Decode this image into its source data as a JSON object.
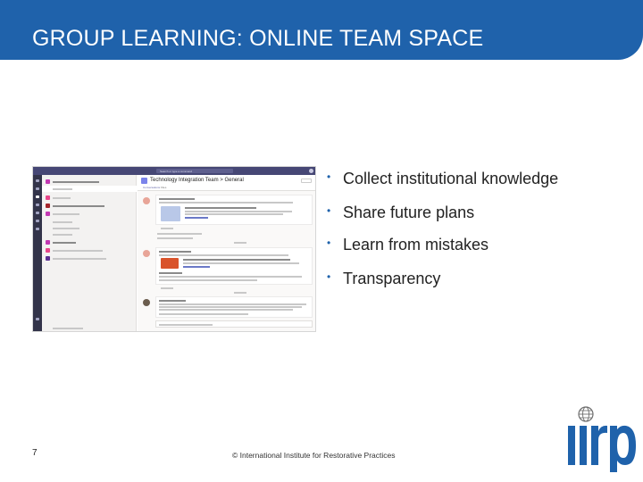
{
  "slide": {
    "title": "GROUP LEARNING: ONLINE TEAM SPACE",
    "page_number": "7",
    "copyright": "© International Institute for Restorative Practices"
  },
  "bullets": [
    "Collect institutional knowledge",
    "Share future plans",
    "Learn from mistakes",
    "Transparency"
  ],
  "screenshot": {
    "channel_title": "Technology Integration Team > General",
    "tabs": [
      "Conversations",
      "Files"
    ],
    "search_placeholder": "Search or type a command"
  },
  "logo": {
    "text": "iirp"
  },
  "colors": {
    "brand_blue": "#1f62ab",
    "teams_purple": "#464775",
    "teams_accent": "#6264a7"
  }
}
